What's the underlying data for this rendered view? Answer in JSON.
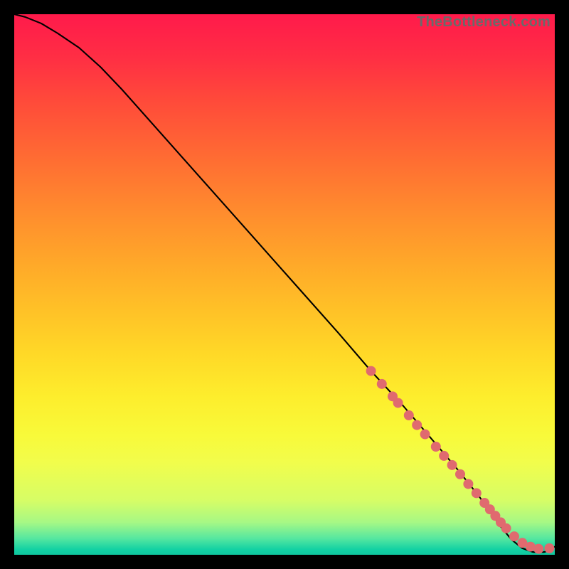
{
  "attribution": "TheBottleneck.com",
  "chart_data": {
    "type": "line",
    "title": "",
    "xlabel": "",
    "ylabel": "",
    "xlim": [
      0,
      100
    ],
    "ylim": [
      0,
      100
    ],
    "grid": false,
    "legend": false,
    "axes_visible": false,
    "series": [
      {
        "name": "curve",
        "style": "line",
        "color": "#000000",
        "x": [
          0,
          2,
          5,
          8,
          12,
          16,
          20,
          28,
          36,
          44,
          52,
          60,
          66,
          72,
          78,
          82,
          86,
          88,
          90,
          92,
          94,
          96,
          97,
          98,
          99,
          100
        ],
        "y": [
          100,
          99.5,
          98.3,
          96.5,
          93.8,
          90.2,
          86,
          77,
          68,
          59,
          50,
          41,
          34,
          27.5,
          20.5,
          15.8,
          10.8,
          8,
          5.2,
          2.8,
          1.2,
          0.5,
          0.5,
          0.5,
          0.8,
          1.5
        ]
      },
      {
        "name": "markers",
        "style": "scatter",
        "color": "#e06a6f",
        "x": [
          66,
          68,
          70,
          71,
          73,
          74.5,
          76,
          78,
          79.5,
          81,
          82.5,
          84,
          85.5,
          87,
          88,
          89,
          90,
          91,
          92.5,
          94,
          95.5,
          97,
          99
        ],
        "y": [
          34,
          31.6,
          29.3,
          28.1,
          25.8,
          24,
          22.3,
          20,
          18.3,
          16.6,
          14.9,
          13.1,
          11.4,
          9.6,
          8.4,
          7.2,
          6,
          4.9,
          3.4,
          2.2,
          1.5,
          1.1,
          1.2
        ]
      }
    ]
  }
}
